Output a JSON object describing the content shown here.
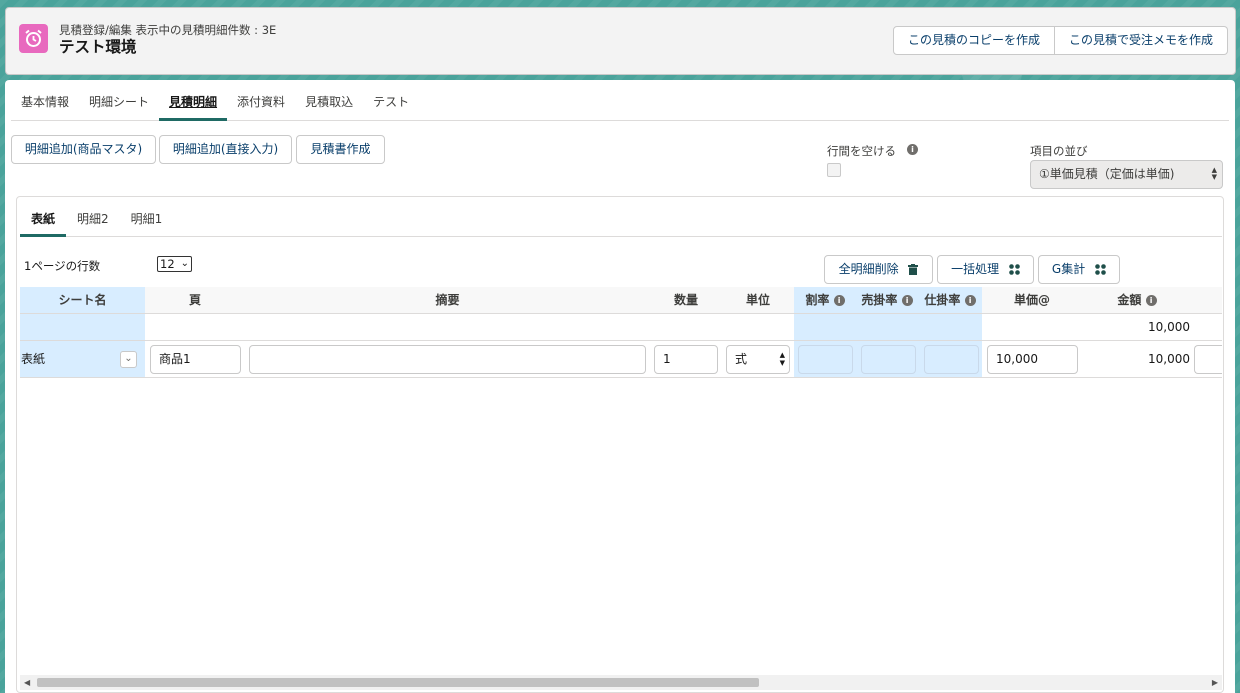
{
  "header": {
    "subtitle": "見積登録/編集 表示中の見積明細件数 : 3E",
    "title": "テスト環境",
    "buttons": [
      "この見積のコピーを作成",
      "この見積で受注メモを作成"
    ]
  },
  "tabs": [
    "基本情報",
    "明細シート",
    "見積明細",
    "添付資料",
    "見積取込",
    "テスト"
  ],
  "toolbar": {
    "add_master": "明細追加(商品マスタ)",
    "add_direct": "明細追加(直接入力)",
    "create_quote": "見積書作成",
    "row_spacing_label": "行間を空ける",
    "order_label": "項目の並び",
    "order_value": "①単価見積（定価は単価)"
  },
  "subtabs": [
    "表紙",
    "明細2",
    "明細1"
  ],
  "rows_per_page": {
    "label": "1ページの行数",
    "value": "12"
  },
  "actions": {
    "delete_all": "全明細削除",
    "bulk": "一括処理",
    "g_total": "G集計"
  },
  "grid": {
    "headers": {
      "sheet": "シート名",
      "page": "頁",
      "summary": "摘要",
      "qty": "数量",
      "unit": "単位",
      "discount": "割率",
      "sell_rate": "売掛率",
      "buy_rate": "仕掛率",
      "unit_price": "単価@",
      "amount": "金額"
    },
    "sum_amount": "10,000",
    "row": {
      "sheet": "表紙",
      "page": "商品1",
      "summary": "",
      "qty": "1",
      "unit": "式",
      "unit_price": "10,000",
      "amount": "10,000"
    }
  },
  "colors": {
    "accent": "#1f6a64",
    "highlight": "#d8edff",
    "app_icon": "#e869be"
  }
}
